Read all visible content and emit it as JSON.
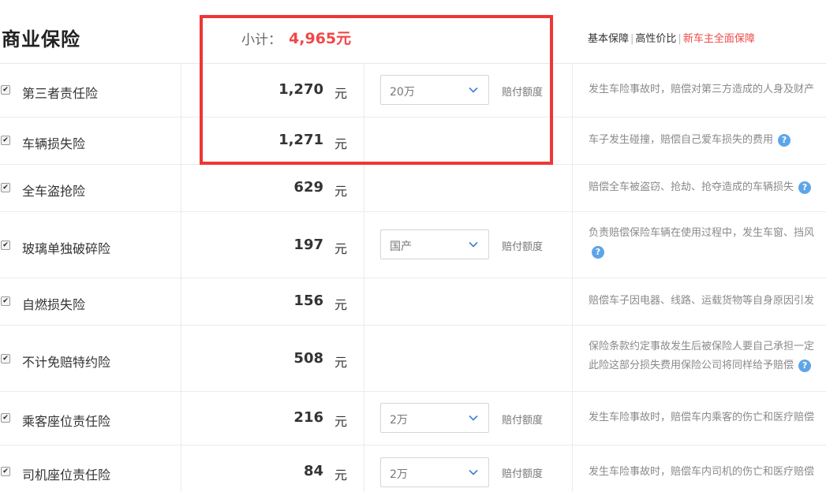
{
  "header": {
    "title": "商业保险",
    "subtotal_label": "小计：",
    "subtotal_value": "4,965元",
    "tags": [
      "基本保障",
      "高性价比",
      "新车主全面保障"
    ]
  },
  "unit_label": "元",
  "claim_label": "赔付额度",
  "help_glyph": "?",
  "check_glyph": "✔",
  "items": [
    {
      "name": "第三者责任险",
      "price": "1,270",
      "select": "20万",
      "desc1": "发生车险事故时，赔偿对第三方造成的人身及财产"
    },
    {
      "name": "车辆损失险",
      "price": "1,271",
      "select": "",
      "desc1": "车子发生碰撞，赔偿自己爱车损失的费用"
    },
    {
      "name": "全车盗抢险",
      "price": "629",
      "select": "",
      "desc1": "赔偿全车被盗窃、抢劫、抢夺造成的车辆损失"
    },
    {
      "name": "玻璃单独破碎险",
      "price": "197",
      "select": "国产",
      "desc1": "负责赔偿保险车辆在使用过程中，发生车窗、挡风"
    },
    {
      "name": "自燃损失险",
      "price": "156",
      "select": "",
      "desc1": "赔偿车子因电器、线路、运载货物等自身原因引发"
    },
    {
      "name": "不计免赔特约险",
      "price": "508",
      "select": "",
      "desc1": "保险条款约定事故发生后被保险人要自己承担一定",
      "desc2": "此险这部分损失费用保险公司将同样给予赔偿"
    },
    {
      "name": "乘客座位责任险",
      "price": "216",
      "select": "2万",
      "desc1": "发生车险事故时，赔偿车内乘客的伤亡和医疗赔偿"
    },
    {
      "name": "司机座位责任险",
      "price": "84",
      "select": "2万",
      "desc1": "发生车险事故时，赔偿车内司机的伤亡和医疗赔偿"
    }
  ]
}
